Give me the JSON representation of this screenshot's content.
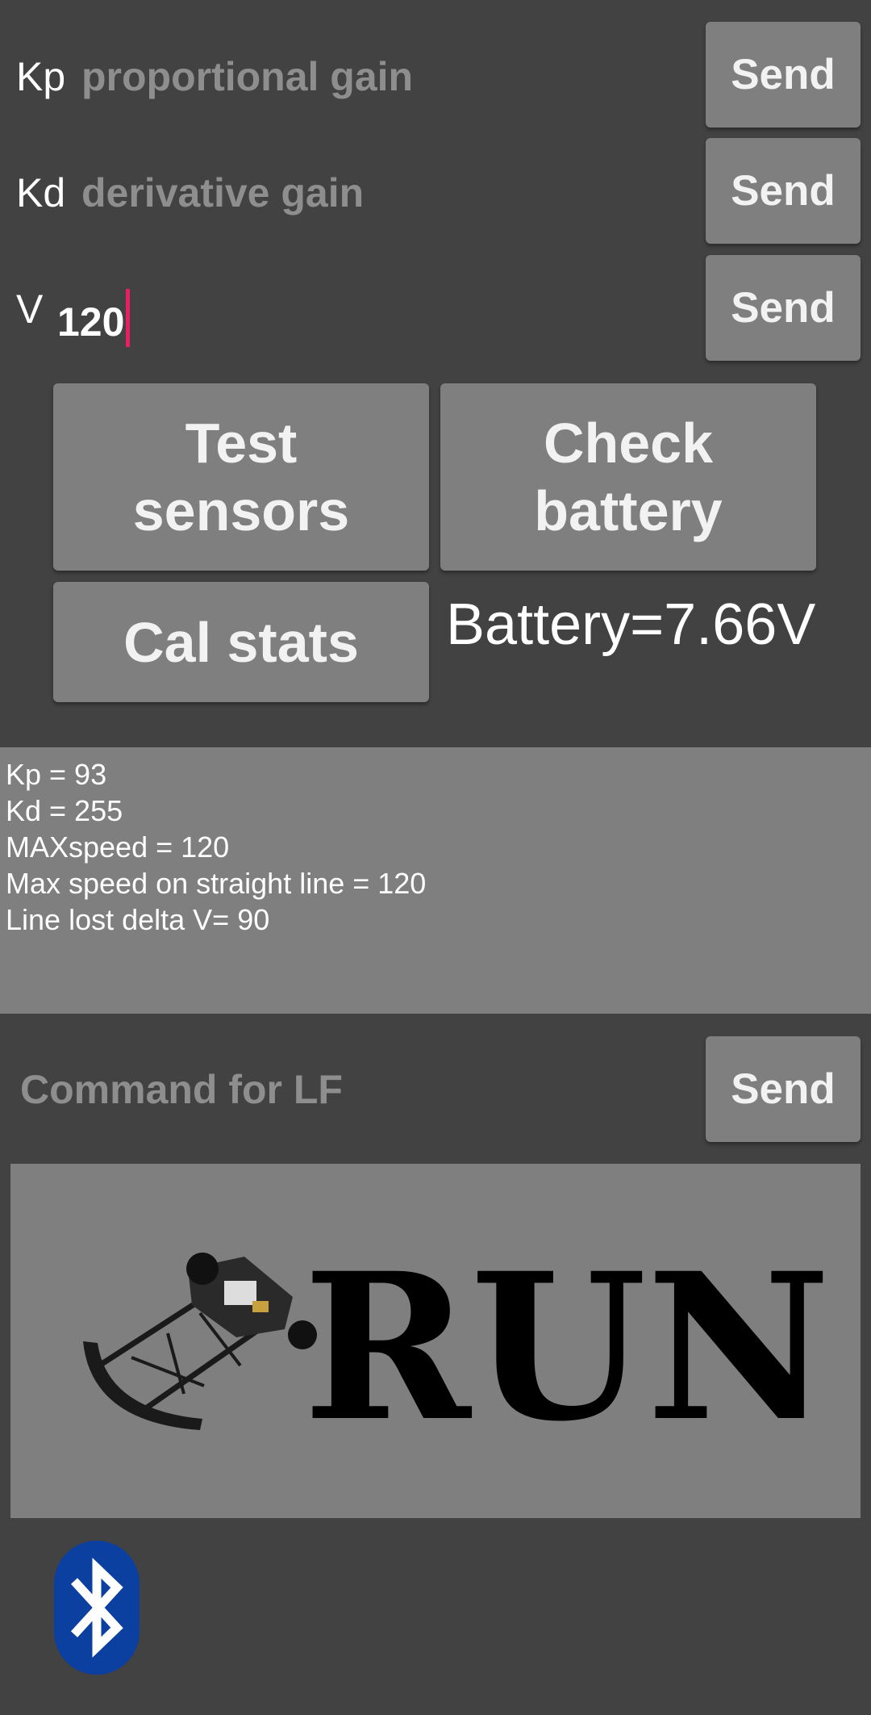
{
  "params": [
    {
      "label": "Kp",
      "value": "",
      "placeholder": "proportional gain",
      "send_label": "Send"
    },
    {
      "label": "Kd",
      "value": "",
      "placeholder": "derivative gain",
      "send_label": "Send"
    },
    {
      "label": "V",
      "value": "120",
      "placeholder": "",
      "send_label": "Send"
    }
  ],
  "actions": {
    "test_sensors": "Test sensors",
    "check_battery": "Check battery",
    "cal_stats": "Cal stats"
  },
  "battery_reading": "Battery=7.66V",
  "stats_lines": [
    "Kp = 93",
    "Kd = 255",
    "MAXspeed = 120",
    "Max speed on straight line = 120",
    "Line lost delta V= 90"
  ],
  "command": {
    "placeholder": "Command for LF",
    "value": "",
    "send_label": "Send"
  },
  "run_button": {
    "label": "RUN",
    "icon": "robot-chassis-icon"
  },
  "bluetooth": {
    "icon": "bluetooth-icon",
    "color": "#0b3fa0"
  },
  "colors": {
    "background": "#424242",
    "button": "#7f7f7f",
    "caret": "#e91e63"
  }
}
